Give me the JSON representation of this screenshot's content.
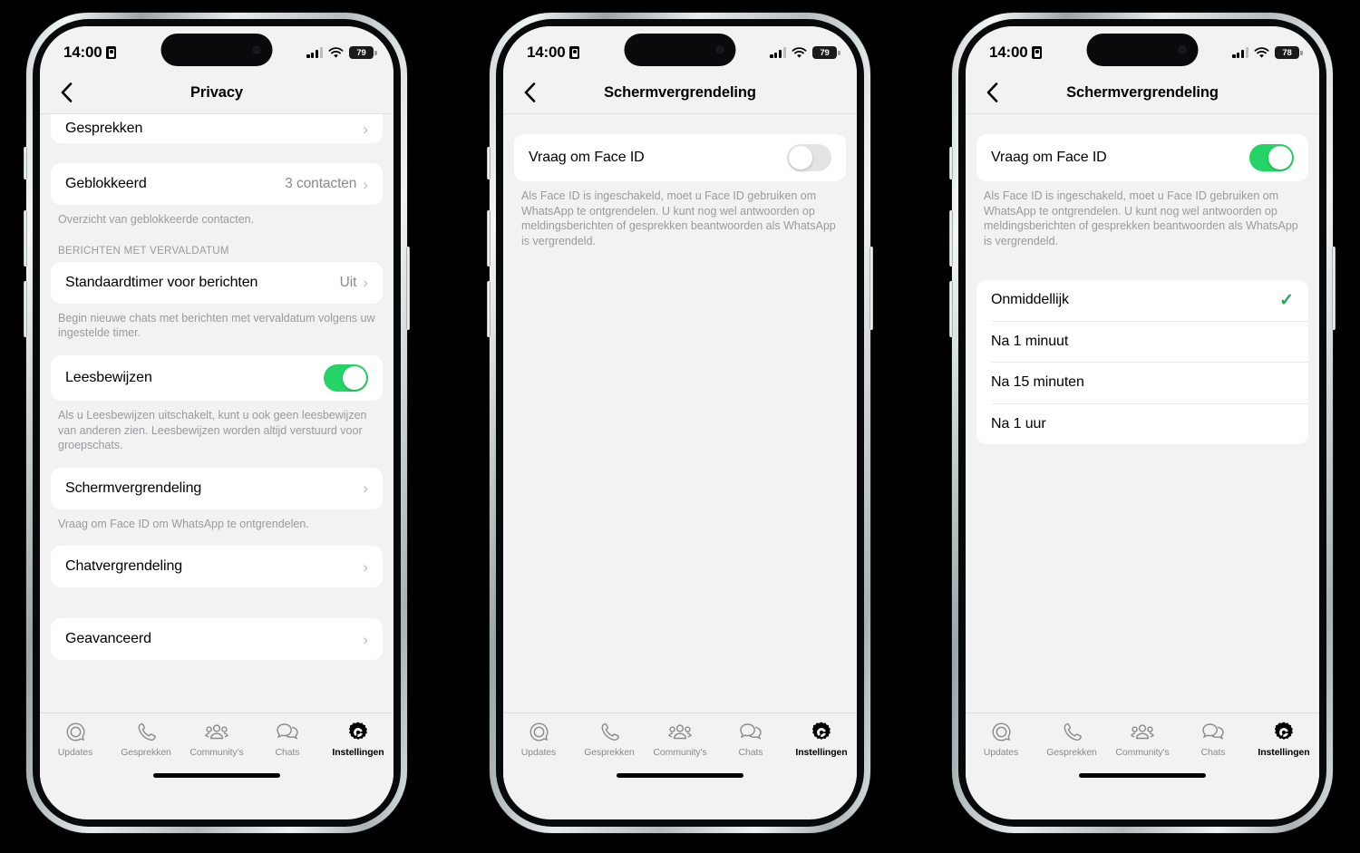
{
  "status_bar": {
    "time": "14:00",
    "recording_icon": "recording-indicator-icon",
    "signal_icon": "cellular-signal-icon",
    "wifi_icon": "wifi-icon",
    "battery_p1": "79",
    "battery_p2": "79",
    "battery_p3": "78"
  },
  "tabbar": {
    "items": [
      {
        "label": "Updates",
        "icon": "updates-icon",
        "active": false
      },
      {
        "label": "Gesprekken",
        "icon": "calls-icon",
        "active": false
      },
      {
        "label": "Community's",
        "icon": "communities-icon",
        "active": false
      },
      {
        "label": "Chats",
        "icon": "chats-icon",
        "active": false
      },
      {
        "label": "Instellingen",
        "icon": "settings-gear-icon",
        "active": true
      }
    ]
  },
  "phone1": {
    "nav": {
      "title": "Privacy",
      "back_icon": "chevron-left-icon"
    },
    "rows": {
      "gesprekken": {
        "label": "Gesprekken",
        "chevron": "›"
      },
      "geblokkeerd": {
        "label": "Geblokkeerd",
        "value": "3 contacten",
        "chevron": "›"
      },
      "geblokkeerd_note": "Overzicht van geblokkeerde contacten.",
      "section_header": "BERICHTEN MET VERVALDATUM",
      "standaardtimer": {
        "label": "Standaardtimer voor berichten",
        "value": "Uit",
        "chevron": "›"
      },
      "standaardtimer_note": "Begin nieuwe chats met berichten met vervaldatum volgens uw ingestelde timer.",
      "leesbewijzen": {
        "label": "Leesbewijzen",
        "toggle_state": "on"
      },
      "leesbewijzen_note": "Als u Leesbewijzen uitschakelt, kunt u ook geen leesbewijzen van anderen zien. Leesbewijzen worden altijd verstuurd voor groepschats.",
      "schermvergrendeling": {
        "label": "Schermvergrendeling",
        "chevron": "›"
      },
      "schermvergrendeling_note": "Vraag om Face ID om WhatsApp te ontgrendelen.",
      "chatvergrendeling": {
        "label": "Chatvergrendeling",
        "chevron": "›"
      },
      "geavanceerd": {
        "label": "Geavanceerd",
        "chevron": "›"
      }
    }
  },
  "phone2": {
    "nav": {
      "title": "Schermvergrendeling",
      "back_icon": "chevron-left-icon"
    },
    "face_id": {
      "label": "Vraag om Face ID",
      "toggle_state": "off"
    },
    "face_id_note": "Als Face ID is ingeschakeld, moet u Face ID gebruiken om WhatsApp te ontgrendelen. U kunt nog wel antwoorden op meldingsberichten of gesprekken beantwoorden als WhatsApp is vergrendeld."
  },
  "phone3": {
    "nav": {
      "title": "Schermvergrendeling",
      "back_icon": "chevron-left-icon"
    },
    "face_id": {
      "label": "Vraag om Face ID",
      "toggle_state": "on"
    },
    "face_id_note": "Als Face ID is ingeschakeld, moet u Face ID gebruiken om WhatsApp te ontgrendelen. U kunt nog wel antwoorden op meldingsberichten of gesprekken beantwoorden als WhatsApp is vergrendeld.",
    "lock_options": [
      {
        "label": "Onmiddellijk",
        "selected": true,
        "check": "✓"
      },
      {
        "label": "Na 1 minuut",
        "selected": false,
        "check": ""
      },
      {
        "label": "Na 15 minuten",
        "selected": false,
        "check": ""
      },
      {
        "label": "Na 1 uur",
        "selected": false,
        "check": ""
      }
    ]
  },
  "colors": {
    "toggle_on": "#25d366",
    "toggle_off": "#e4e4e6",
    "checkmark": "#1fa855",
    "screen_bg": "#f2f2f2",
    "card_bg": "#ffffff",
    "secondary_text": "#9a9a9e"
  }
}
